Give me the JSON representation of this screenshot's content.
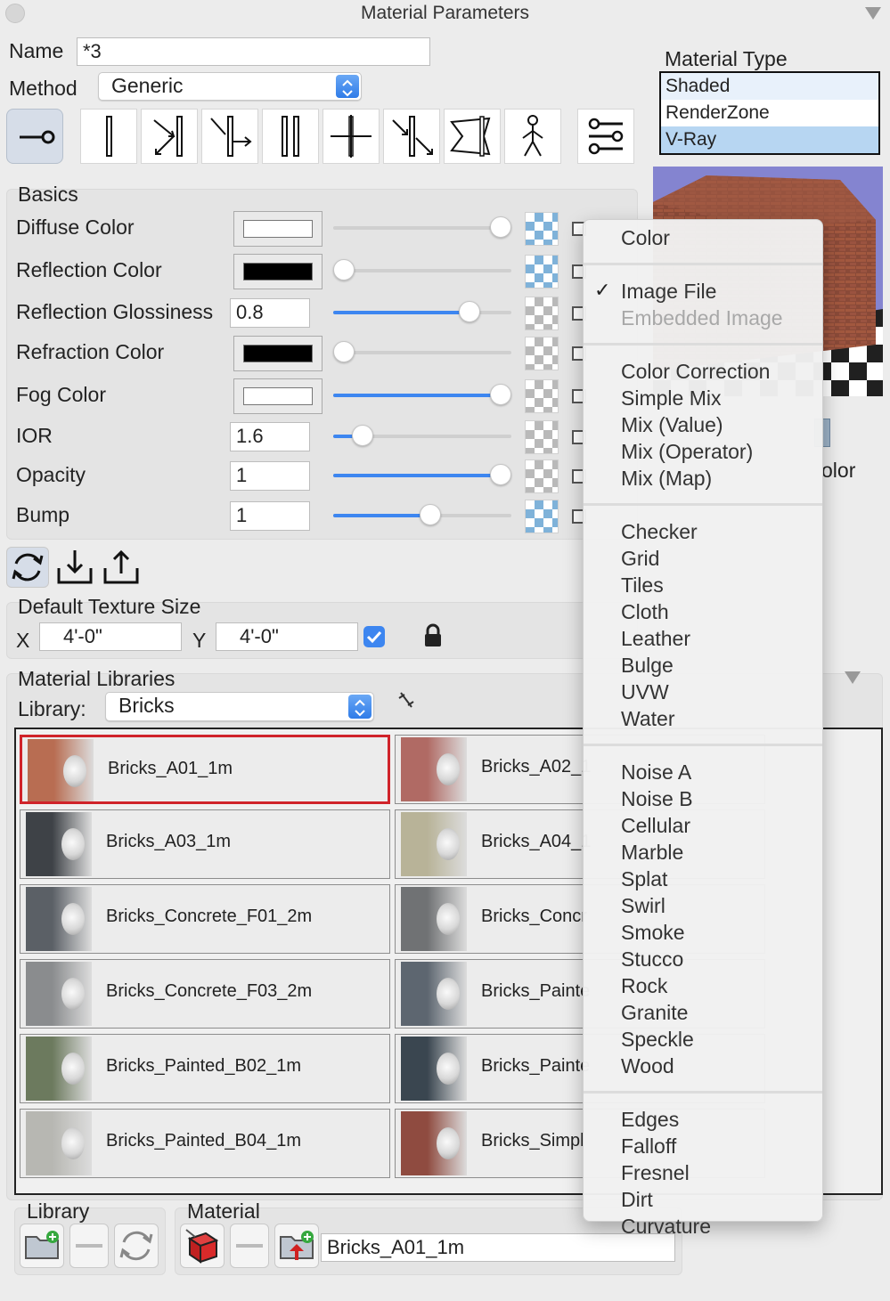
{
  "window": {
    "title": "Material Parameters"
  },
  "name_field": {
    "label": "Name",
    "value": "*3"
  },
  "method": {
    "label": "Method",
    "value": "Generic"
  },
  "material_type": {
    "title": "Material Type",
    "items": [
      "Shaded",
      "RenderZone",
      "V-Ray"
    ],
    "selected": "V-Ray"
  },
  "basics": {
    "title": "Basics",
    "rows": [
      {
        "label": "Diffuse Color",
        "kind": "swatch",
        "swatch_color": "#ffffff",
        "level": 1.0,
        "filled": false,
        "tex": "blue"
      },
      {
        "label": "Reflection Color",
        "kind": "swatch",
        "swatch_color": "#000000",
        "level": 0.0,
        "filled": false,
        "tex": "blue"
      },
      {
        "label": "Reflection Glossiness",
        "kind": "value",
        "value": "0.8",
        "level": 0.8,
        "filled": true,
        "tex": "gray"
      },
      {
        "label": "Refraction Color",
        "kind": "swatch",
        "swatch_color": "#000000",
        "level": 0.0,
        "filled": false,
        "tex": "gray"
      },
      {
        "label": "Fog Color",
        "kind": "swatch",
        "swatch_color": "#ffffff",
        "level": 1.0,
        "filled": true,
        "tex": "gray"
      },
      {
        "label": "IOR",
        "kind": "value",
        "value": "1.6",
        "level": 0.12,
        "filled": true,
        "tex": "gray"
      },
      {
        "label": "Opacity",
        "kind": "value",
        "value": "1",
        "level": 1.0,
        "filled": true,
        "tex": "gray"
      },
      {
        "label": "Bump",
        "kind": "value",
        "value": "1",
        "level": 0.55,
        "filled": true,
        "tex": "blue"
      }
    ]
  },
  "texture_size": {
    "title": "Default Texture Size",
    "x_label": "X",
    "x_value": "4'-0\"",
    "y_label": "Y",
    "y_value": "4'-0\"",
    "linked": true
  },
  "libraries": {
    "title": "Material Libraries",
    "library_label": "Library:",
    "library_value": "Bricks",
    "items": [
      {
        "name": "Bricks_A01_1m",
        "color": "#b86d52",
        "selected": true
      },
      {
        "name": "Bricks_A02_1",
        "color": "#b06a64",
        "selected": false
      },
      {
        "name": "Bricks_A03_1m",
        "color": "#3e4247",
        "selected": false
      },
      {
        "name": "Bricks_A04_1",
        "color": "#b8b398",
        "selected": false
      },
      {
        "name": "Bricks_Concrete_F01_2m",
        "color": "#5b6066",
        "selected": false
      },
      {
        "name": "Bricks_Concr",
        "color": "#707274",
        "selected": false
      },
      {
        "name": "Bricks_Concrete_F03_2m",
        "color": "#8a8c8e",
        "selected": false
      },
      {
        "name": "Bricks_Painte",
        "color": "#5d6670",
        "selected": false
      },
      {
        "name": "Bricks_Painted_B02_1m",
        "color": "#6c7a5e",
        "selected": false
      },
      {
        "name": "Bricks_Painte",
        "color": "#3a4650",
        "selected": false
      },
      {
        "name": "Bricks_Painted_B04_1m",
        "color": "#b7b7b2",
        "selected": false
      },
      {
        "name": "Bricks_Simpl",
        "color": "#8f4b40",
        "selected": false
      }
    ]
  },
  "bottom": {
    "library_group": "Library",
    "material_group": "Material",
    "material_name": "Bricks_A01_1m"
  },
  "partial_label": "olor",
  "texture_menu": {
    "groups": [
      [
        {
          "label": "Color"
        }
      ],
      [
        {
          "label": "Image File",
          "checked": true
        },
        {
          "label": "Embedded Image",
          "disabled": true
        }
      ],
      [
        {
          "label": "Color Correction"
        },
        {
          "label": "Simple Mix"
        },
        {
          "label": "Mix (Value)"
        },
        {
          "label": "Mix (Operator)"
        },
        {
          "label": "Mix (Map)"
        }
      ],
      [
        {
          "label": "Checker"
        },
        {
          "label": "Grid"
        },
        {
          "label": "Tiles"
        },
        {
          "label": "Cloth"
        },
        {
          "label": "Leather"
        },
        {
          "label": "Bulge"
        },
        {
          "label": "UVW"
        },
        {
          "label": "Water"
        }
      ],
      [
        {
          "label": "Noise A"
        },
        {
          "label": "Noise B"
        },
        {
          "label": "Cellular"
        },
        {
          "label": "Marble"
        },
        {
          "label": "Splat"
        },
        {
          "label": "Swirl"
        },
        {
          "label": "Smoke"
        },
        {
          "label": "Stucco"
        },
        {
          "label": "Rock"
        },
        {
          "label": "Granite"
        },
        {
          "label": "Speckle"
        },
        {
          "label": "Wood"
        }
      ],
      [
        {
          "label": "Edges"
        },
        {
          "label": "Falloff"
        },
        {
          "label": "Fresnel"
        },
        {
          "label": "Dirt"
        },
        {
          "label": "Curvature"
        }
      ]
    ],
    "check_glyph": "✓"
  },
  "colors": {
    "accent": "#3d86f0",
    "selection_red": "#d0232a",
    "vray_highlight": "#b7d6f2"
  }
}
